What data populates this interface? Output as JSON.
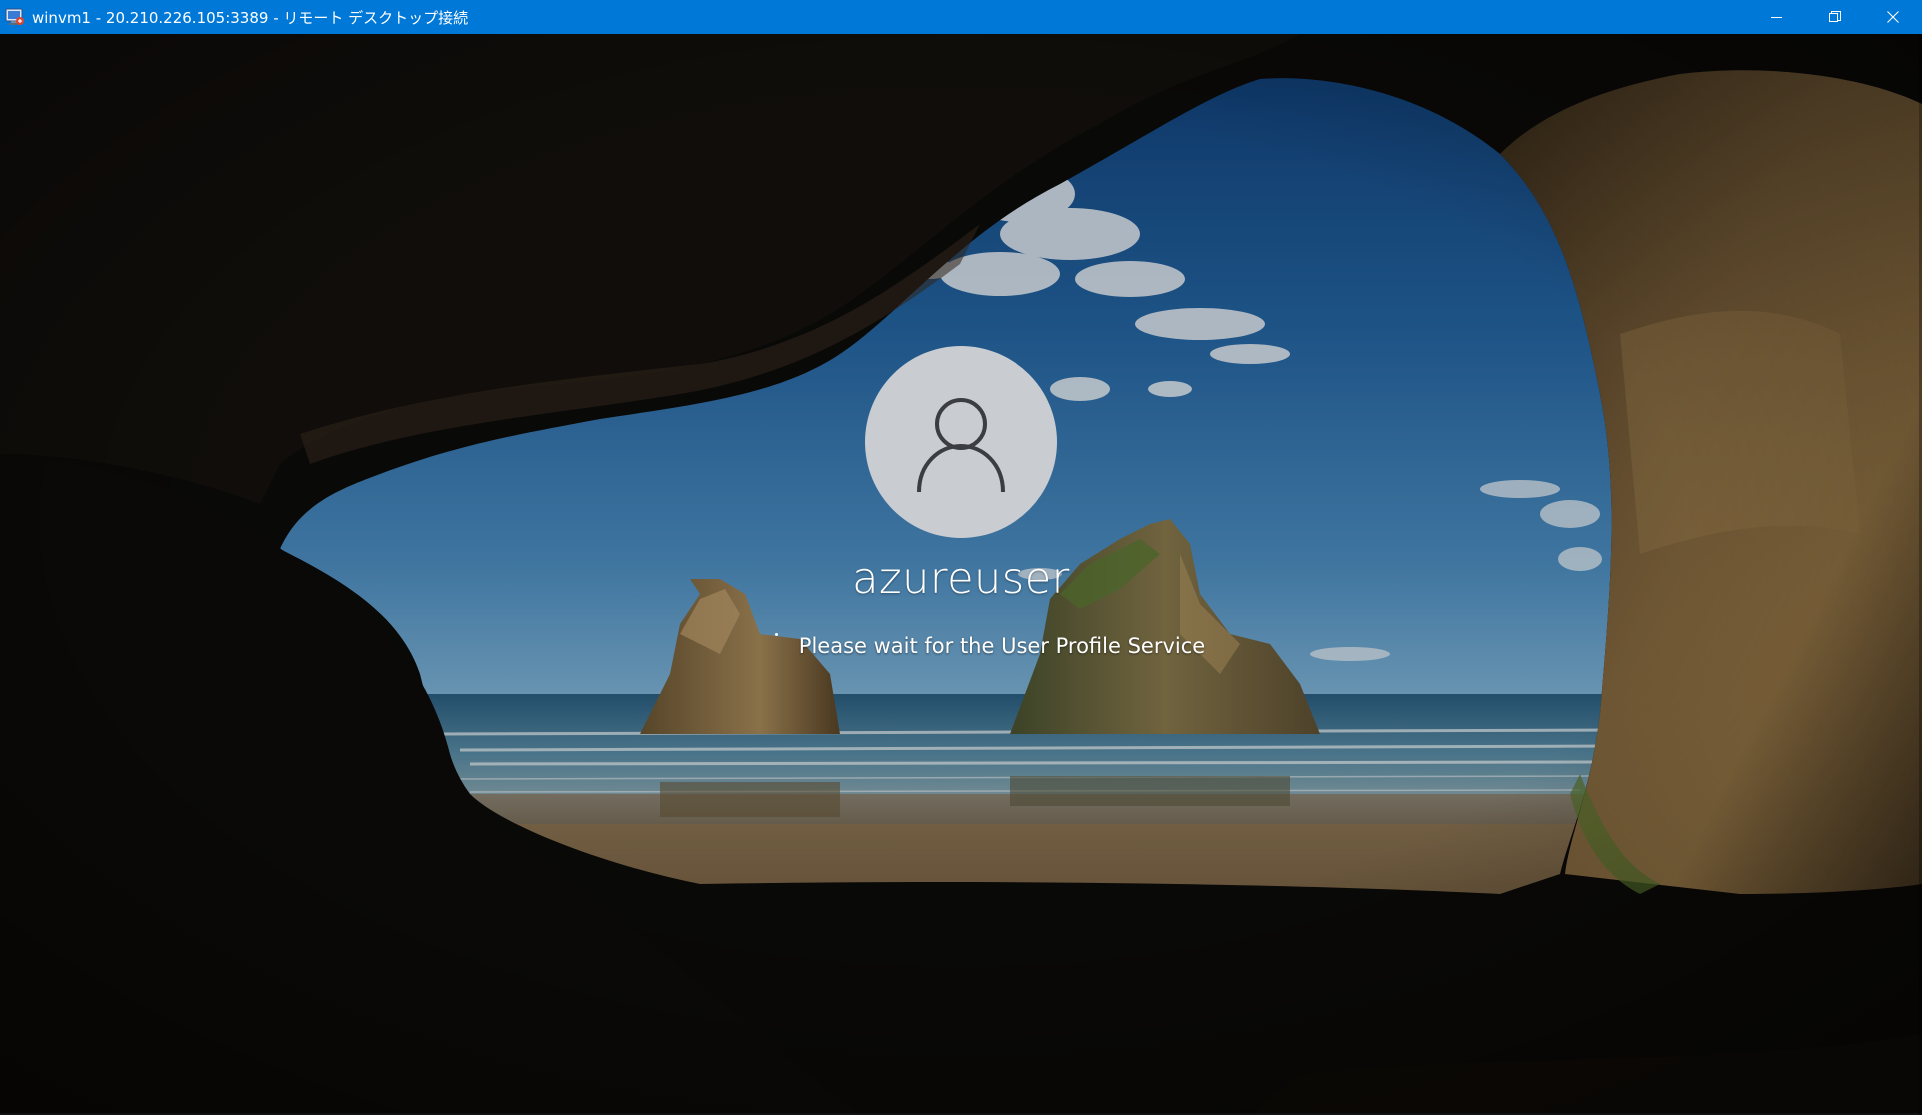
{
  "window": {
    "title": "winvm1 - 20.210.226.105:3389 - リモート デスクトップ接続",
    "titlebar_color": "#0078d7",
    "buttons": {
      "minimize_icon": "minimize-icon",
      "restore_icon": "restore-icon",
      "close_icon": "close-icon"
    }
  },
  "lock_screen": {
    "username": "azureuser",
    "status": "Please wait for the User Profile Service",
    "avatar_icon": "user-silhouette-icon",
    "spinner_icon": "loading-dots-icon"
  }
}
